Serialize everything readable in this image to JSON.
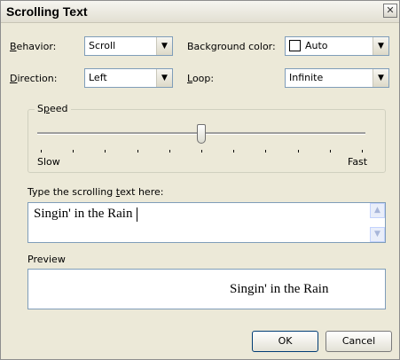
{
  "dialog": {
    "title": "Scrolling Text",
    "close_glyph": "✕"
  },
  "behavior": {
    "prefix": "",
    "accel": "B",
    "suffix": "ehavior:",
    "value": "Scroll"
  },
  "background_color": {
    "prefix": "Background color:",
    "value": "Auto"
  },
  "direction": {
    "accel": "D",
    "suffix": "irection:",
    "value": "Left"
  },
  "loop": {
    "accel": "L",
    "suffix": "oop:",
    "value": "Infinite"
  },
  "speed": {
    "title_a": "S",
    "title_accel": "p",
    "title_b": "eed",
    "min_label": "Slow",
    "max_label": "Fast",
    "level_fraction": 0.5,
    "tick_count": 10
  },
  "text_entry": {
    "label_a": "Type the scrolling ",
    "label_accel": "t",
    "label_b": "ext here:",
    "value": "Singin' in the Rain"
  },
  "preview": {
    "label": "Preview",
    "text": "Singin' in the Rain"
  },
  "buttons": {
    "ok": "OK",
    "cancel": "Cancel"
  },
  "icons": {
    "dropdown": "chevron-down-icon",
    "scroll_up": "arrow-up-icon",
    "scroll_down": "arrow-down-icon",
    "close": "close-icon"
  },
  "colors": {
    "dialog_bg": "#ECE9D8",
    "field_border": "#7f9db9"
  }
}
